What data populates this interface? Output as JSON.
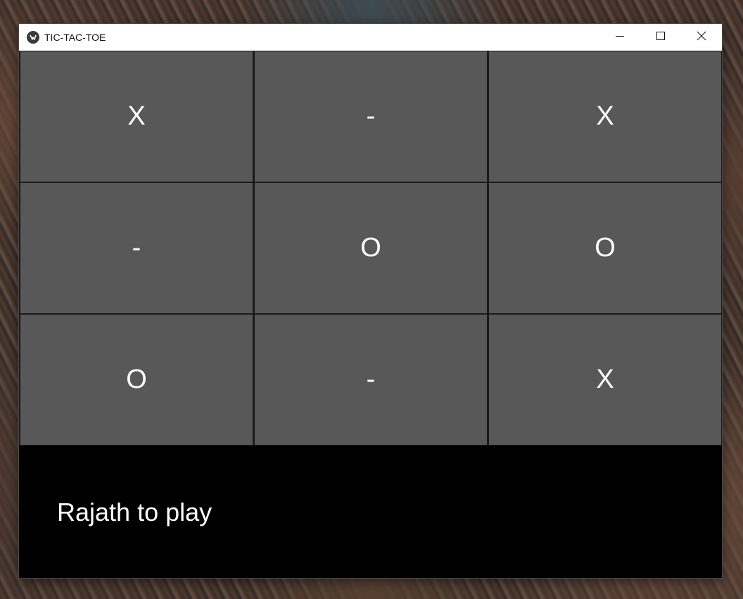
{
  "window": {
    "title": "TIC-TAC-TOE"
  },
  "board": {
    "cells": [
      [
        "X",
        "-",
        "X"
      ],
      [
        "-",
        "O",
        "O"
      ],
      [
        "O",
        "-",
        "X"
      ]
    ]
  },
  "status": {
    "text": "Rajath to play"
  },
  "icons": {
    "app": "kivy-app-icon",
    "minimize": "minimize-icon",
    "maximize": "maximize-icon",
    "close": "close-icon"
  },
  "colors": {
    "cell_bg": "#585858",
    "cell_text": "#ffffff",
    "status_bg": "#000000",
    "titlebar_bg": "#ffffff"
  }
}
